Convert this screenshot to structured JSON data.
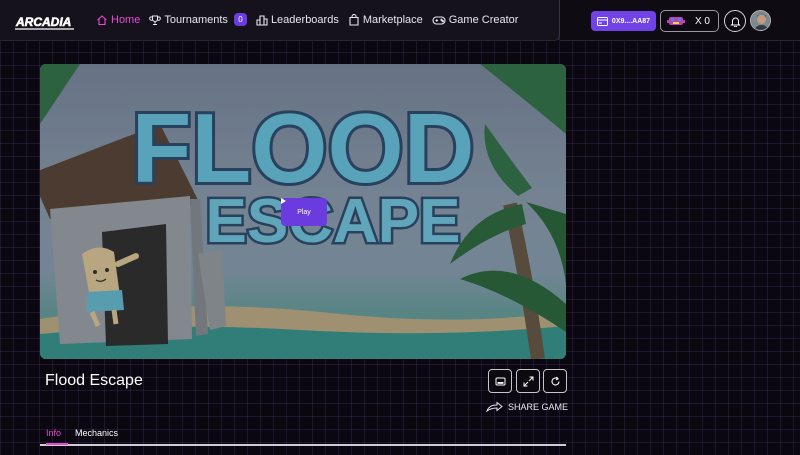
{
  "brand": {
    "logo_text": "ARCADIA"
  },
  "nav": {
    "items": [
      {
        "label": "Home",
        "icon": "home-icon",
        "active": true
      },
      {
        "label": "Tournaments",
        "icon": "trophy-icon",
        "badge": "0"
      },
      {
        "label": "Leaderboards",
        "icon": "leaderboard-icon"
      },
      {
        "label": "Marketplace",
        "icon": "bag-icon"
      },
      {
        "label": "Game Creator",
        "icon": "gamepad-icon"
      }
    ]
  },
  "account": {
    "wallet_address": "0X9....AA87",
    "token_count": "X 0",
    "token_icon": "invader-token-icon"
  },
  "game": {
    "banner_title_line1": "FLOOD",
    "banner_title_line2": "ESCAPE",
    "play_label": "Play",
    "title": "Flood Escape",
    "share_label": "SHARE GAME"
  },
  "tabs": [
    {
      "label": "Info",
      "active": true
    },
    {
      "label": "Mechanics",
      "active": false
    }
  ],
  "colors": {
    "accent": "#e44ad6",
    "primary": "#6b3be0",
    "background": "#0b0711"
  }
}
